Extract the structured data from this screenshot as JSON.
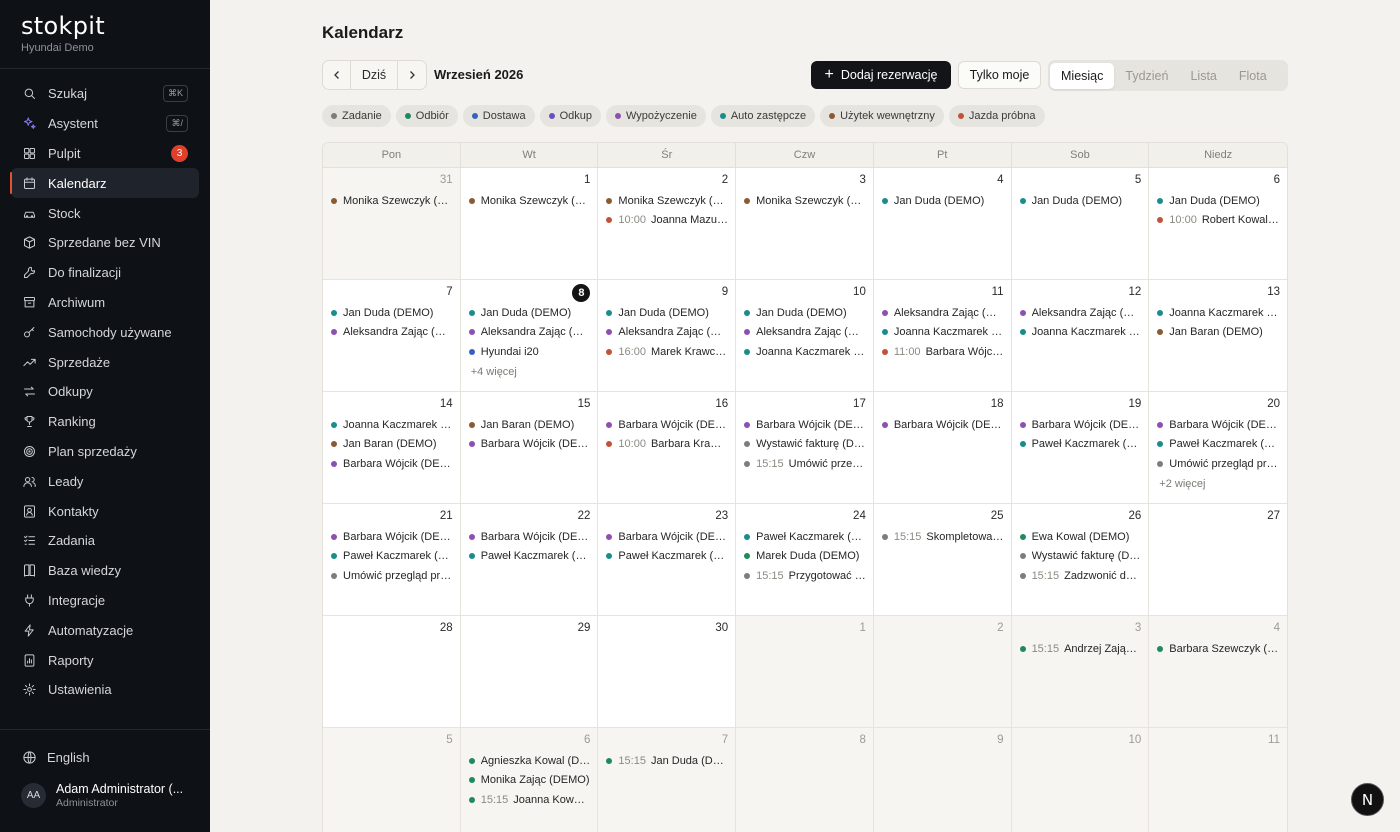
{
  "brand": {
    "name": "stokpit",
    "subtitle": "Hyundai Demo"
  },
  "nav": [
    {
      "label": "Szukaj",
      "icon": "search-icon",
      "shortcut": "⌘K"
    },
    {
      "label": "Asystent",
      "icon": "sparkles-icon",
      "shortcut": "⌘/"
    },
    {
      "label": "Pulpit",
      "icon": "dashboard-icon",
      "badge": "3"
    },
    {
      "label": "Kalendarz",
      "icon": "calendar-icon",
      "active": true
    },
    {
      "label": "Stock",
      "icon": "car-icon"
    },
    {
      "label": "Sprzedane bez VIN",
      "icon": "box-icon"
    },
    {
      "label": "Do finalizacji",
      "icon": "wrench-icon"
    },
    {
      "label": "Archiwum",
      "icon": "archive-icon"
    },
    {
      "label": "Samochody używane",
      "icon": "key-icon"
    },
    {
      "label": "Sprzedaże",
      "icon": "trending-up-icon"
    },
    {
      "label": "Odkupy",
      "icon": "swap-icon"
    },
    {
      "label": "Ranking",
      "icon": "trophy-icon"
    },
    {
      "label": "Plan sprzedaży",
      "icon": "target-icon"
    },
    {
      "label": "Leady",
      "icon": "users-icon"
    },
    {
      "label": "Kontakty",
      "icon": "contact-icon"
    },
    {
      "label": "Zadania",
      "icon": "tasks-icon"
    },
    {
      "label": "Baza wiedzy",
      "icon": "book-icon"
    },
    {
      "label": "Integracje",
      "icon": "plug-icon"
    },
    {
      "label": "Automatyzacje",
      "icon": "bolt-icon"
    },
    {
      "label": "Raporty",
      "icon": "report-icon"
    },
    {
      "label": "Ustawienia",
      "icon": "gear-icon"
    }
  ],
  "language": "English",
  "user": {
    "initials": "AA",
    "name": "Adam Administrator (...",
    "role": "Administrator"
  },
  "page": {
    "title": "Kalendarz"
  },
  "toolbar": {
    "today_label": "Dziś",
    "month_label": "Wrzesień 2026",
    "add_label": "Dodaj rezerwację",
    "mine_label": "Tylko moje",
    "views": [
      {
        "label": "Miesiąc",
        "active": true
      },
      {
        "label": "Tydzień"
      },
      {
        "label": "Lista"
      },
      {
        "label": "Flota"
      }
    ]
  },
  "colors": {
    "zadanie": "#7d7d7d",
    "odbior": "#1f8a5a",
    "dostawa": "#3b5fc0",
    "odkup": "#6a4fc4",
    "wypozyczenie": "#8e4fb3",
    "zastepcze": "#1a8c8c",
    "wewnetrzny": "#8a5a32",
    "probna": "#c0543a"
  },
  "legend": [
    {
      "label": "Zadanie",
      "type": "zadanie"
    },
    {
      "label": "Odbiór",
      "type": "odbior"
    },
    {
      "label": "Dostawa",
      "type": "dostawa"
    },
    {
      "label": "Odkup",
      "type": "odkup"
    },
    {
      "label": "Wypożyczenie",
      "type": "wypozyczenie"
    },
    {
      "label": "Auto zastępcze",
      "type": "zastepcze"
    },
    {
      "label": "Użytek wewnętrzny",
      "type": "wewnetrzny"
    },
    {
      "label": "Jazda próbna",
      "type": "probna"
    }
  ],
  "weekdays": [
    "Pon",
    "Wt",
    "Śr",
    "Czw",
    "Pt",
    "Sob",
    "Niedz"
  ],
  "weeks": [
    [
      {
        "day": "31",
        "other": true,
        "events": [
          {
            "type": "wewnetrzny",
            "text": "Monika Szewczyk (DEMO)"
          }
        ]
      },
      {
        "day": "1",
        "events": [
          {
            "type": "wewnetrzny",
            "text": "Monika Szewczyk (DEMO)"
          }
        ]
      },
      {
        "day": "2",
        "events": [
          {
            "type": "wewnetrzny",
            "text": "Monika Szewczyk (DEMO)"
          },
          {
            "type": "probna",
            "time": "10:00",
            "text": "Joanna Mazur (DEMO)"
          }
        ]
      },
      {
        "day": "3",
        "events": [
          {
            "type": "wewnetrzny",
            "text": "Monika Szewczyk (DEMO)"
          }
        ]
      },
      {
        "day": "4",
        "events": [
          {
            "type": "zastepcze",
            "text": "Jan Duda (DEMO)"
          }
        ]
      },
      {
        "day": "5",
        "events": [
          {
            "type": "zastepcze",
            "text": "Jan Duda (DEMO)"
          }
        ]
      },
      {
        "day": "6",
        "events": [
          {
            "type": "zastepcze",
            "text": "Jan Duda (DEMO)"
          },
          {
            "type": "probna",
            "time": "10:00",
            "text": "Robert Kowalski (DEMO)"
          }
        ]
      }
    ],
    [
      {
        "day": "7",
        "events": [
          {
            "type": "zastepcze",
            "text": "Jan Duda (DEMO)"
          },
          {
            "type": "wypozyczenie",
            "text": "Aleksandra Zając (DEMO)"
          }
        ]
      },
      {
        "day": "8",
        "today": true,
        "events": [
          {
            "type": "zastepcze",
            "text": "Jan Duda (DEMO)"
          },
          {
            "type": "wypozyczenie",
            "text": "Aleksandra Zając (DEMO)"
          },
          {
            "type": "dostawa",
            "text": "Hyundai i20"
          }
        ],
        "more": "+4 więcej"
      },
      {
        "day": "9",
        "events": [
          {
            "type": "zastepcze",
            "text": "Jan Duda (DEMO)"
          },
          {
            "type": "wypozyczenie",
            "text": "Aleksandra Zając (DEMO)"
          },
          {
            "type": "probna",
            "time": "16:00",
            "text": "Marek Krawczyk (DEMO)"
          }
        ]
      },
      {
        "day": "10",
        "events": [
          {
            "type": "zastepcze",
            "text": "Jan Duda (DEMO)"
          },
          {
            "type": "wypozyczenie",
            "text": "Aleksandra Zając (DEMO)"
          },
          {
            "type": "zastepcze",
            "text": "Joanna Kaczmarek (DEMO)"
          }
        ]
      },
      {
        "day": "11",
        "events": [
          {
            "type": "wypozyczenie",
            "text": "Aleksandra Zając (DEMO)"
          },
          {
            "type": "zastepcze",
            "text": "Joanna Kaczmarek (DEMO)"
          },
          {
            "type": "probna",
            "time": "11:00",
            "text": "Barbara Wójcik (DEMO)"
          }
        ]
      },
      {
        "day": "12",
        "events": [
          {
            "type": "wypozyczenie",
            "text": "Aleksandra Zając (DEMO)"
          },
          {
            "type": "zastepcze",
            "text": "Joanna Kaczmarek (DEMO)"
          }
        ]
      },
      {
        "day": "13",
        "events": [
          {
            "type": "zastepcze",
            "text": "Joanna Kaczmarek (DEMO)"
          },
          {
            "type": "wewnetrzny",
            "text": "Jan Baran (DEMO)"
          }
        ]
      }
    ],
    [
      {
        "day": "14",
        "events": [
          {
            "type": "zastepcze",
            "text": "Joanna Kaczmarek (DEMO)"
          },
          {
            "type": "wewnetrzny",
            "text": "Jan Baran (DEMO)"
          },
          {
            "type": "wypozyczenie",
            "text": "Barbara Wójcik (DEMO)"
          }
        ]
      },
      {
        "day": "15",
        "events": [
          {
            "type": "wewnetrzny",
            "text": "Jan Baran (DEMO)"
          },
          {
            "type": "wypozyczenie",
            "text": "Barbara Wójcik (DEMO)"
          }
        ]
      },
      {
        "day": "16",
        "events": [
          {
            "type": "wypozyczenie",
            "text": "Barbara Wójcik (DEMO)"
          },
          {
            "type": "probna",
            "time": "10:00",
            "text": "Barbara Krawczyk (DEMO)"
          }
        ]
      },
      {
        "day": "17",
        "events": [
          {
            "type": "wypozyczenie",
            "text": "Barbara Wójcik (DEMO)"
          },
          {
            "type": "zadanie",
            "text": "Wystawić fakturę (DEMO)"
          },
          {
            "type": "zadanie",
            "time": "15:15",
            "text": "Umówić przegląd"
          }
        ]
      },
      {
        "day": "18",
        "events": [
          {
            "type": "wypozyczenie",
            "text": "Barbara Wójcik (DEMO)"
          }
        ]
      },
      {
        "day": "19",
        "events": [
          {
            "type": "wypozyczenie",
            "text": "Barbara Wójcik (DEMO)"
          },
          {
            "type": "zastepcze",
            "text": "Paweł Kaczmarek (DEMO)"
          }
        ]
      },
      {
        "day": "20",
        "events": [
          {
            "type": "wypozyczenie",
            "text": "Barbara Wójcik (DEMO)"
          },
          {
            "type": "zastepcze",
            "text": "Paweł Kaczmarek (DEMO)"
          },
          {
            "type": "zadanie",
            "text": "Umówić przegląd przeglądu"
          }
        ],
        "more": "+2 więcej"
      }
    ],
    [
      {
        "day": "21",
        "events": [
          {
            "type": "wypozyczenie",
            "text": "Barbara Wójcik (DEMO)"
          },
          {
            "type": "zastepcze",
            "text": "Paweł Kaczmarek (DEMO)"
          },
          {
            "type": "zadanie",
            "text": "Umówić przegląd przeglądu"
          }
        ]
      },
      {
        "day": "22",
        "events": [
          {
            "type": "wypozyczenie",
            "text": "Barbara Wójcik (DEMO)"
          },
          {
            "type": "zastepcze",
            "text": "Paweł Kaczmarek (DEMO)"
          }
        ]
      },
      {
        "day": "23",
        "events": [
          {
            "type": "wypozyczenie",
            "text": "Barbara Wójcik (DEMO)"
          },
          {
            "type": "zastepcze",
            "text": "Paweł Kaczmarek (DEMO)"
          }
        ]
      },
      {
        "day": "24",
        "events": [
          {
            "type": "zastepcze",
            "text": "Paweł Kaczmarek (DEMO)"
          },
          {
            "type": "odbior",
            "text": "Marek Duda (DEMO)"
          },
          {
            "type": "zadanie",
            "time": "15:15",
            "text": "Przygotować auto"
          }
        ]
      },
      {
        "day": "25",
        "events": [
          {
            "type": "zadanie",
            "time": "15:15",
            "text": "Skompletować dokumenty"
          }
        ]
      },
      {
        "day": "26",
        "events": [
          {
            "type": "odbior",
            "text": "Ewa Kowal (DEMO)"
          },
          {
            "type": "zadanie",
            "text": "Wystawić fakturę (DEMO)"
          },
          {
            "type": "zadanie",
            "time": "15:15",
            "text": "Zadzwonić do klienta"
          }
        ]
      },
      {
        "day": "27",
        "events": []
      }
    ],
    [
      {
        "day": "28",
        "events": []
      },
      {
        "day": "29",
        "events": []
      },
      {
        "day": "30",
        "events": []
      },
      {
        "day": "1",
        "other": true,
        "events": []
      },
      {
        "day": "2",
        "other": true,
        "events": []
      },
      {
        "day": "3",
        "other": true,
        "events": [
          {
            "type": "odbior",
            "time": "15:15",
            "text": "Andrzej Zając (DEMO)"
          }
        ]
      },
      {
        "day": "4",
        "other": true,
        "events": [
          {
            "type": "odbior",
            "text": "Barbara Szewczyk (DEMO)"
          }
        ]
      }
    ],
    [
      {
        "day": "5",
        "other": true,
        "events": []
      },
      {
        "day": "6",
        "other": true,
        "events": [
          {
            "type": "odbior",
            "text": "Agnieszka Kowal (DEMO)"
          },
          {
            "type": "odbior",
            "text": "Monika Zając (DEMO)"
          },
          {
            "type": "odbior",
            "time": "15:15",
            "text": "Joanna Kowalska"
          }
        ]
      },
      {
        "day": "7",
        "other": true,
        "events": [
          {
            "type": "odbior",
            "time": "15:15",
            "text": "Jan Duda (DEMO)"
          }
        ]
      },
      {
        "day": "8",
        "other": true,
        "events": []
      },
      {
        "day": "9",
        "other": true,
        "events": []
      },
      {
        "day": "10",
        "other": true,
        "events": []
      },
      {
        "day": "11",
        "other": true,
        "events": []
      }
    ]
  ],
  "fab_label": "N"
}
